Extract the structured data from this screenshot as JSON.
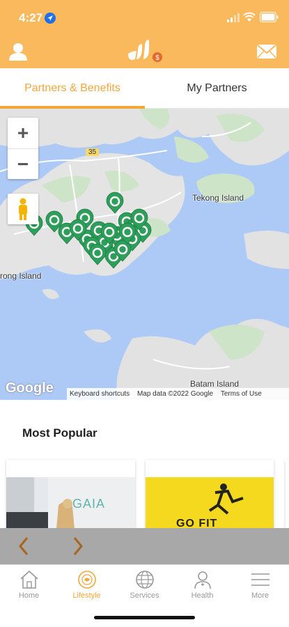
{
  "status_bar": {
    "time": "4:27",
    "icons": [
      "location-arrow-icon",
      "signal-icon",
      "wifi-icon",
      "battery-icon"
    ]
  },
  "app_bar": {
    "left_icon": "user-icon",
    "logo": "app-logo",
    "right_icon": "mail-icon",
    "brand_color": "#F9B95C"
  },
  "tabs": [
    {
      "label": "Partners & Benefits",
      "active": true
    },
    {
      "label": "My Partners",
      "active": false
    }
  ],
  "map": {
    "labels": {
      "tekong": "Tekong Island",
      "pulau": "rong Island",
      "batam": "Batam Island",
      "road": "35"
    },
    "zoom_in": "+",
    "zoom_out": "−",
    "google": "Google",
    "attribution": [
      "Keyboard shortcuts",
      "Map data ©2022 Google",
      "Terms of Use"
    ],
    "marker_color": "#2E9E5B"
  },
  "section": {
    "title": "Most Popular"
  },
  "cards": [
    {
      "brand": "GAIA"
    },
    {
      "brand": "GO FIT"
    }
  ],
  "bottom_nav": [
    {
      "label": "Home",
      "icon": "home-icon",
      "active": false
    },
    {
      "label": "Lifestyle",
      "icon": "lifestyle-icon",
      "active": true
    },
    {
      "label": "Services",
      "icon": "globe-icon",
      "active": false
    },
    {
      "label": "Health",
      "icon": "health-icon",
      "active": false
    },
    {
      "label": "More",
      "icon": "menu-icon",
      "active": false
    }
  ]
}
